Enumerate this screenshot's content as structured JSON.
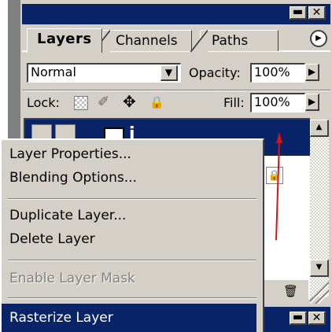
{
  "palette": {
    "tabs": [
      {
        "label": "Layers"
      },
      {
        "label": "Channels"
      },
      {
        "label": "Paths"
      }
    ],
    "blend_mode": "Normal",
    "opacity_label": "Opacity:",
    "opacity_value": "100%",
    "lock_label": "Lock:",
    "fill_label": "Fill:",
    "fill_value": "100%",
    "window_minimize_glyph": "▬",
    "window_close_glyph": "✕",
    "layer_name_partial": "i",
    "menu_arrow_glyph": "▶"
  },
  "context_menu": {
    "items": [
      {
        "label": "Layer Properties...",
        "enabled": true,
        "selected": false
      },
      {
        "label": "Blending Options...",
        "enabled": true,
        "selected": false
      },
      {
        "label": "Duplicate Layer...",
        "enabled": true,
        "selected": false
      },
      {
        "label": "Delete Layer",
        "enabled": true,
        "selected": false
      },
      {
        "label": "Enable Layer Mask",
        "enabled": false,
        "selected": false
      },
      {
        "label": "Rasterize Layer",
        "enabled": true,
        "selected": true
      }
    ]
  },
  "colors": {
    "title_bar": "#0a246a",
    "face": "#d4d0c8",
    "shadow": "#808080",
    "highlight_text": "#ffffff",
    "disabled_text": "#808080",
    "annotation_line": "#e01010"
  },
  "icons": [
    "minimize-icon",
    "close-icon",
    "palette-menu-arrow-icon",
    "dropdown-arrow-icon",
    "stepper-arrow-icon",
    "lock-transparency-icon",
    "lock-paint-icon",
    "lock-move-icon",
    "lock-all-icon",
    "eye-icon",
    "link-icon",
    "layer-thumbnail-icon",
    "lock-indicator-icon",
    "trash-icon",
    "resize-grip-icon"
  ]
}
